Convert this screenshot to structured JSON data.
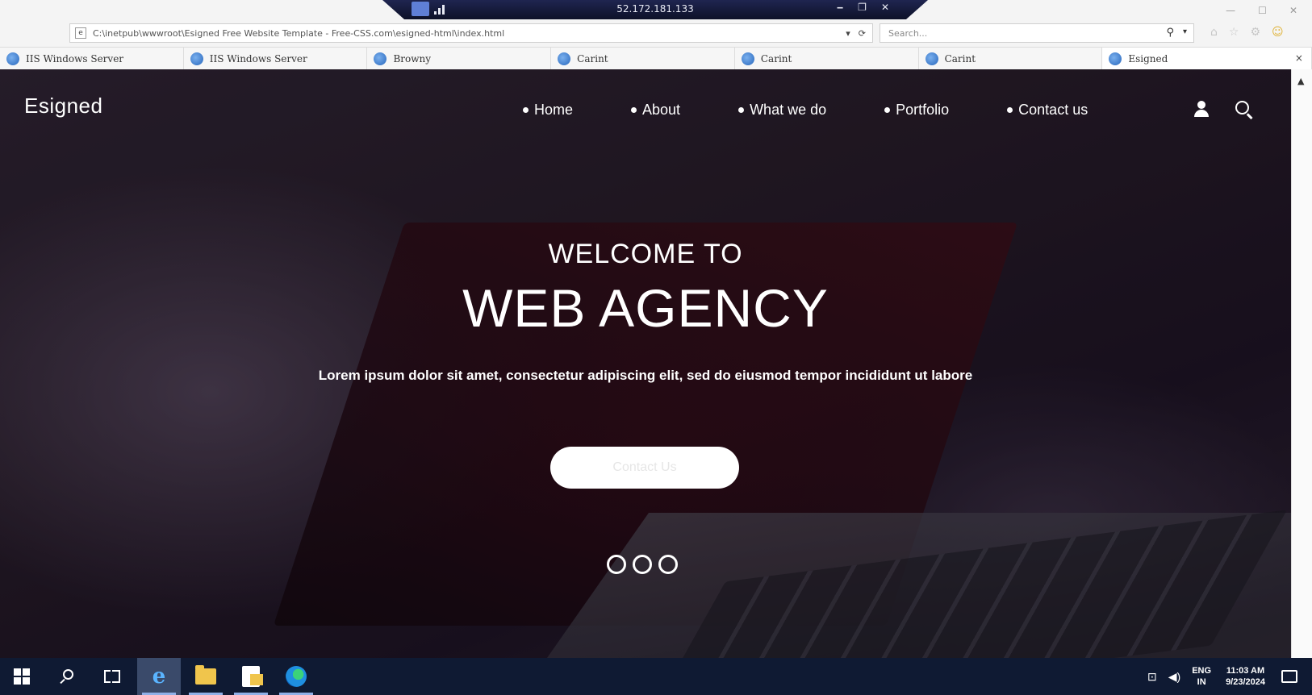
{
  "remote_bar": {
    "ip": "52.172.181.133",
    "pin_icon": "pin-icon",
    "signal_icon": "signal-icon",
    "minimize": "‒",
    "restore": "❐",
    "close": "✕"
  },
  "browser": {
    "url": "C:\\inetpub\\wwwroot\\Esigned Free Website Template - Free-CSS.com\\esigned-html\\index.html",
    "search_placeholder": "Search...",
    "refresh_symbol": "⟳",
    "dropdown_symbol": "▾",
    "search_symbol": "⚲",
    "home_symbol": "⌂",
    "star_symbol": "☆",
    "settings_symbol": "⚙",
    "smile_symbol": "☺",
    "window_minimize": "—",
    "window_maximize": "☐",
    "window_close": "✕",
    "tabs": [
      {
        "label": "IIS Windows Server"
      },
      {
        "label": "IIS Windows Server"
      },
      {
        "label": "Browny"
      },
      {
        "label": "Carint"
      },
      {
        "label": "Carint"
      },
      {
        "label": "Carint"
      },
      {
        "label": "Esigned"
      }
    ],
    "tab_close": "×",
    "scroll_up": "▲"
  },
  "site": {
    "brand": "Esigned",
    "menu": [
      {
        "label": "Home"
      },
      {
        "label": "About"
      },
      {
        "label": "What we do"
      },
      {
        "label": "Portfolio"
      },
      {
        "label": "Contact us"
      }
    ],
    "hero": {
      "welcome": "WELCOME TO",
      "title": "WEB AGENCY",
      "lead": "Lorem ipsum dolor sit amet, consectetur adipiscing elit, sed do eiusmod tempor incididunt ut labore",
      "cta": "Contact Us",
      "slides": 3
    }
  },
  "taskbar": {
    "lang": "ENG",
    "region": "IN",
    "time": "11:03 AM",
    "date": "9/23/2024",
    "network_symbol": "⊡",
    "volume_symbol": "◀)"
  }
}
